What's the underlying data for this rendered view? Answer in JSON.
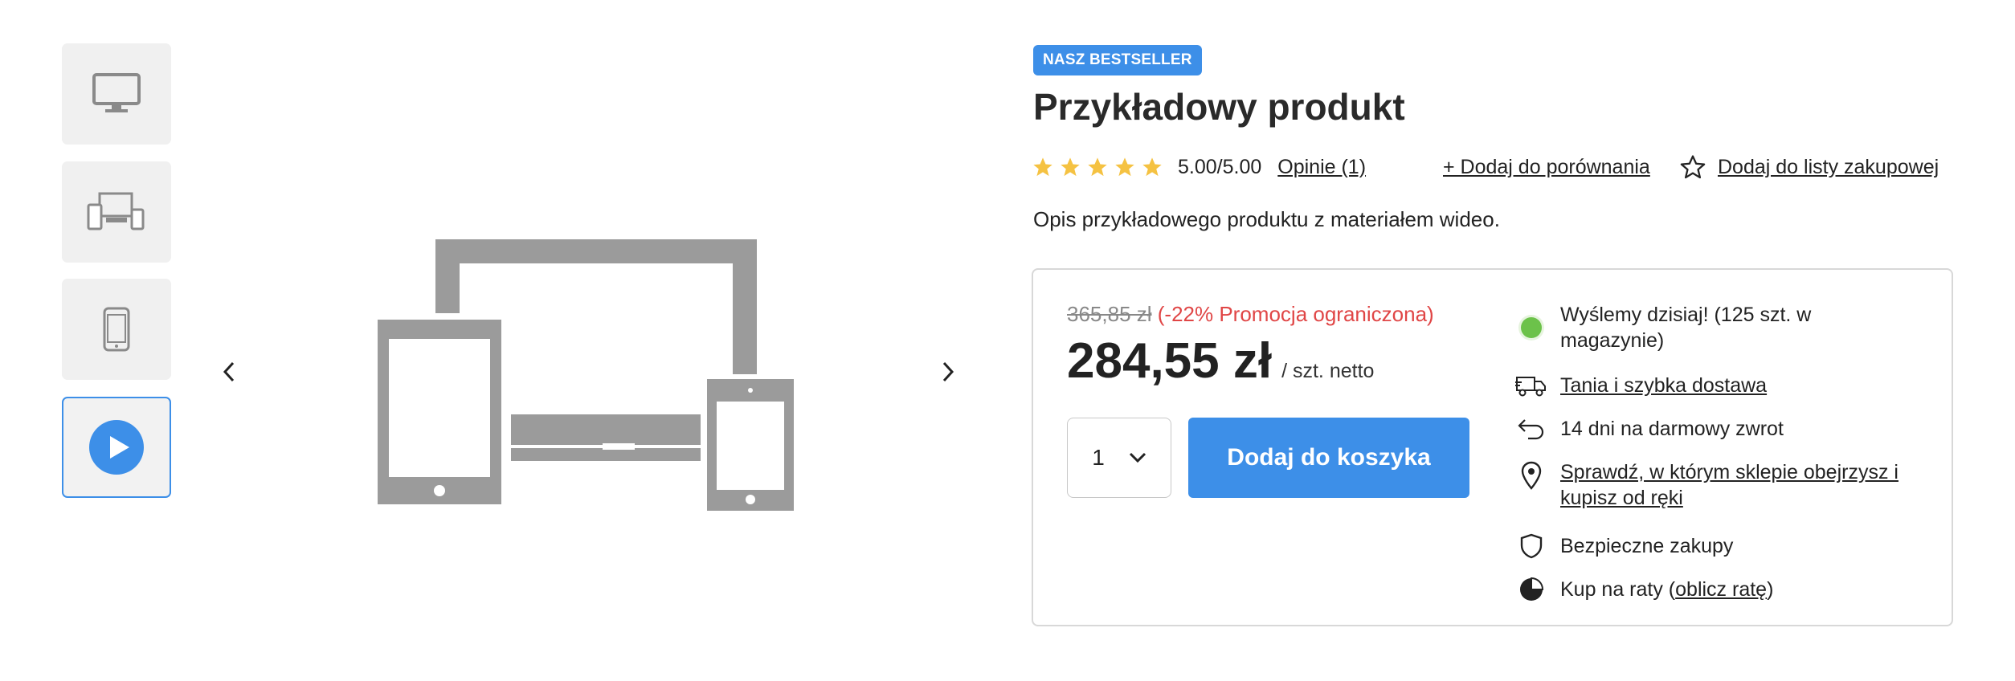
{
  "gallery": {
    "thumbnails": [
      {
        "icon": "desktop-monitor-icon",
        "active": false
      },
      {
        "icon": "multiple-devices-icon",
        "active": false
      },
      {
        "icon": "smartphone-icon",
        "active": false
      },
      {
        "icon": "play-video-icon",
        "active": true
      }
    ],
    "main_image_icon": "devices-illustration-icon",
    "prev_icon": "chevron-left-icon",
    "next_icon": "chevron-right-icon"
  },
  "product": {
    "badge": "NASZ BESTSELLER",
    "title": "Przykładowy produkt",
    "rating": {
      "stars": 5,
      "value_text": "5.00/5.00",
      "reviews_label": "Opinie (1)"
    },
    "compare_label": "+ Dodaj do porównania",
    "wishlist_label": "Dodaj do listy zakupowej",
    "description": "Opis przykładowego produktu z materiałem wideo."
  },
  "pricing": {
    "old_price": "365,85 zł",
    "promo_text": "(-22% Promocja ograniczona)",
    "price": "284,55 zł",
    "unit_label": "/ szt. netto",
    "quantity": "1",
    "add_to_cart_label": "Dodaj do koszyka"
  },
  "features": {
    "shipping_today": "Wyślemy dzisiaj! (125 szt. w magazynie)",
    "delivery_label": "Tania i szybka dostawa",
    "returns": "14 dni na darmowy zwrot",
    "store_check": "Sprawdź, w którym sklepie obejrzysz i kupisz od ręki",
    "safe_shopping": "Bezpieczne zakupy",
    "installments_prefix": "Kup na raty (",
    "installments_link": "oblicz ratę",
    "installments_suffix": ")"
  },
  "colors": {
    "accent": "#3d8fe8",
    "promo": "#e04646",
    "stock_dot": "#6cc24a",
    "star": "#f5c242"
  }
}
